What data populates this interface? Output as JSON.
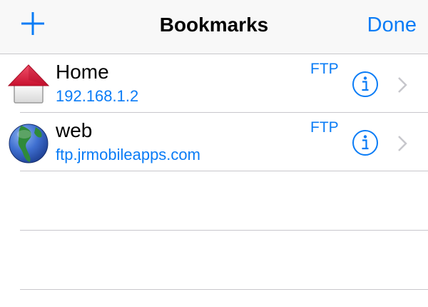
{
  "navbar": {
    "title": "Bookmarks",
    "done_label": "Done",
    "add_icon": "plus-icon"
  },
  "colors": {
    "accent": "#0a7cf6",
    "separator": "#c8c7cc",
    "navbar_bg": "#f8f8f8"
  },
  "bookmarks": [
    {
      "name": "Home",
      "address": "192.168.1.2",
      "protocol": "FTP",
      "icon": "home-icon"
    },
    {
      "name": "web",
      "address": "ftp.jrmobileapps.com",
      "protocol": "FTP",
      "icon": "globe-icon"
    }
  ]
}
